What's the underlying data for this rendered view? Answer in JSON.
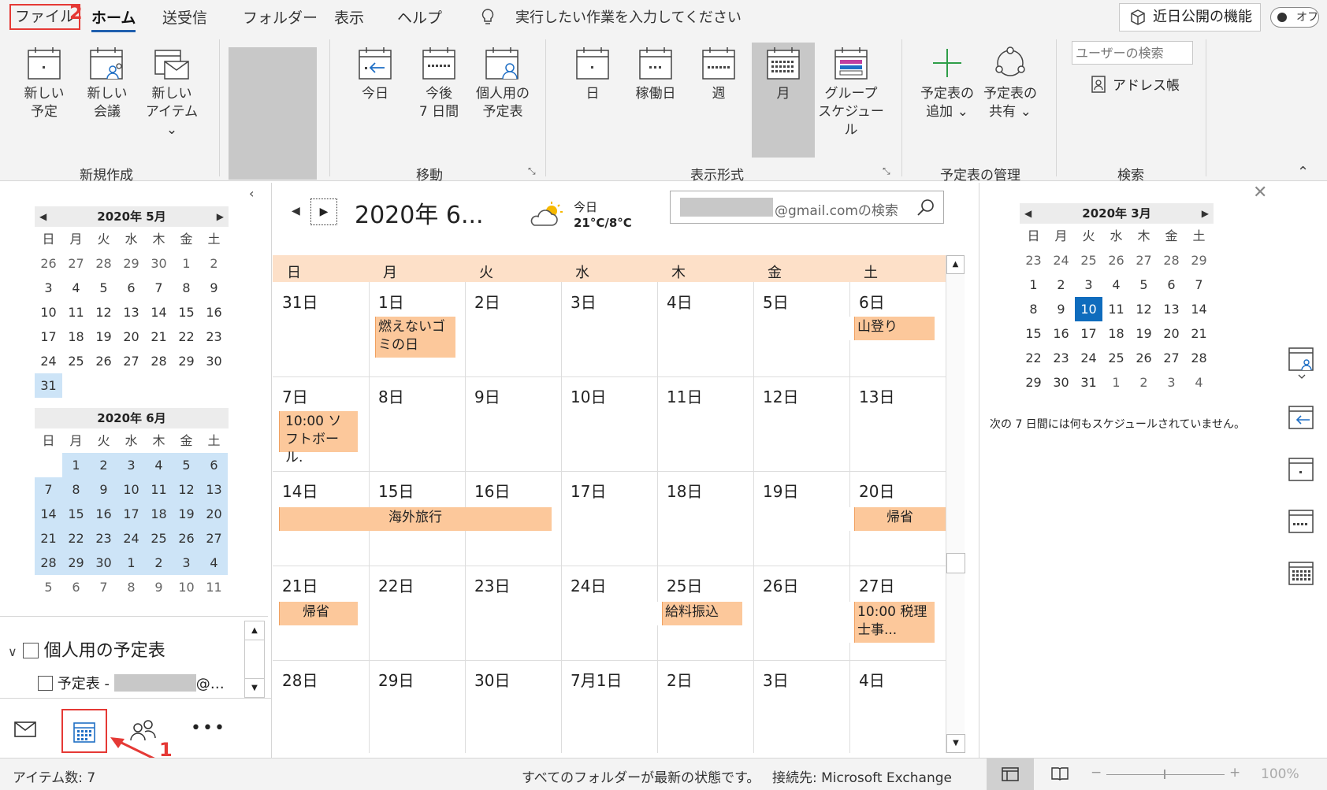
{
  "tabs": {
    "file": "ファイル",
    "home": "ホーム",
    "send_receive": "送受信",
    "folder": "フォルダー",
    "view": "表示",
    "help": "ヘルプ",
    "tell_me": "実行したい作業を入力してください",
    "coming_soon": "近日公開の機能",
    "toggle": "オフ"
  },
  "annotations": {
    "step1": "1",
    "step2": "2"
  },
  "ribbon": {
    "new_appointment": [
      "新しい",
      "予定"
    ],
    "new_meeting": [
      "新しい",
      "会議"
    ],
    "new_items": [
      "新しい",
      "アイテム ⌄"
    ],
    "group_new": "新規作成",
    "today": "今日",
    "next7": [
      "今後",
      "7 日間"
    ],
    "personal_cal": [
      "個人用の",
      "予定表"
    ],
    "group_goto": "移動",
    "day": "日",
    "work_week": "稼働日",
    "week": "週",
    "month": "月",
    "schedule_view": [
      "グループ",
      "スケジュール"
    ],
    "group_arrange": "表示形式",
    "open_calendar": [
      "予定表の",
      "追加 ⌄"
    ],
    "share_calendar": [
      "予定表の",
      "共有 ⌄"
    ],
    "group_manage": "予定表の管理",
    "search_people_placeholder": "ユーザーの検索",
    "address_book": "アドレス帳",
    "group_find": "検索"
  },
  "left": {
    "may": {
      "title": "2020年 5月",
      "headers": [
        "日",
        "月",
        "火",
        "水",
        "木",
        "金",
        "土"
      ],
      "rows": [
        [
          "26",
          "27",
          "28",
          "29",
          "30",
          "1",
          "2"
        ],
        [
          "3",
          "4",
          "5",
          "6",
          "7",
          "8",
          "9"
        ],
        [
          "10",
          "11",
          "12",
          "13",
          "14",
          "15",
          "16"
        ],
        [
          "17",
          "18",
          "19",
          "20",
          "21",
          "22",
          "23"
        ],
        [
          "24",
          "25",
          "26",
          "27",
          "28",
          "29",
          "30"
        ],
        [
          "31",
          "",
          "",
          "",
          "",
          "",
          ""
        ]
      ]
    },
    "june": {
      "title": "2020年 6月",
      "headers": [
        "日",
        "月",
        "火",
        "水",
        "木",
        "金",
        "土"
      ],
      "rows": [
        [
          "",
          "1",
          "2",
          "3",
          "4",
          "5",
          "6"
        ],
        [
          "7",
          "8",
          "9",
          "10",
          "11",
          "12",
          "13"
        ],
        [
          "14",
          "15",
          "16",
          "17",
          "18",
          "19",
          "20"
        ],
        [
          "21",
          "22",
          "23",
          "24",
          "25",
          "26",
          "27"
        ],
        [
          "28",
          "29",
          "30",
          "1",
          "2",
          "3",
          "4"
        ],
        [
          "5",
          "6",
          "7",
          "8",
          "9",
          "10",
          "11"
        ]
      ]
    },
    "folder_group": "個人用の予定表",
    "folder_item_prefix": "予定表 -",
    "folder_item_suffix": "@…"
  },
  "nav": {
    "mail": "mail-icon",
    "calendar": "calendar-icon",
    "people": "people-icon",
    "more": "•••"
  },
  "main": {
    "title": "2020年 6...",
    "weather_today": "今日",
    "weather_temp": "21°C/8°C",
    "search_suffix": "@gmail.comの検索",
    "weekdays": [
      "日",
      "月",
      "火",
      "水",
      "木",
      "金",
      "土"
    ],
    "weeks": [
      [
        "31日",
        "1日",
        "2日",
        "3日",
        "4日",
        "5日",
        "6日"
      ],
      [
        "7日",
        "8日",
        "9日",
        "10日",
        "11日",
        "12日",
        "13日"
      ],
      [
        "14日",
        "15日",
        "16日",
        "17日",
        "18日",
        "19日",
        "20日"
      ],
      [
        "21日",
        "22日",
        "23日",
        "24日",
        "25日",
        "26日",
        "27日"
      ],
      [
        "28日",
        "29日",
        "30日",
        "7月1日",
        "2日",
        "3日",
        "4日"
      ]
    ],
    "events": {
      "burnable": "燃えないゴミの日",
      "hiking": "山登り",
      "softball": "10:00 ソフトボール.",
      "trip": "海外旅行",
      "homecoming1": "帰省",
      "homecoming2": "帰省",
      "salary": "給料振込",
      "tax": "10:00 税理士事..."
    }
  },
  "right": {
    "march": {
      "title": "2020年 3月",
      "headers": [
        "日",
        "月",
        "火",
        "水",
        "木",
        "金",
        "土"
      ],
      "rows": [
        [
          "23",
          "24",
          "25",
          "26",
          "27",
          "28",
          "29"
        ],
        [
          "1",
          "2",
          "3",
          "4",
          "5",
          "6",
          "7"
        ],
        [
          "8",
          "9",
          "10",
          "11",
          "12",
          "13",
          "14"
        ],
        [
          "15",
          "16",
          "17",
          "18",
          "19",
          "20",
          "21"
        ],
        [
          "22",
          "23",
          "24",
          "25",
          "26",
          "27",
          "28"
        ],
        [
          "29",
          "30",
          "31",
          "1",
          "2",
          "3",
          "4"
        ]
      ]
    },
    "no_schedule": "次の 7 日間には何もスケジュールされていません。"
  },
  "status": {
    "item_count": "アイテム数: 7",
    "folders_status": "すべてのフォルダーが最新の状態です。",
    "connection": "接続先: Microsoft Exchange",
    "zoom": "100%"
  },
  "colors": {
    "event": "#fcc89b",
    "weekday_header": "#fde0c8",
    "selected_range": "#cde4f7",
    "today": "#0f6cbd",
    "annotation": "#e53935"
  }
}
